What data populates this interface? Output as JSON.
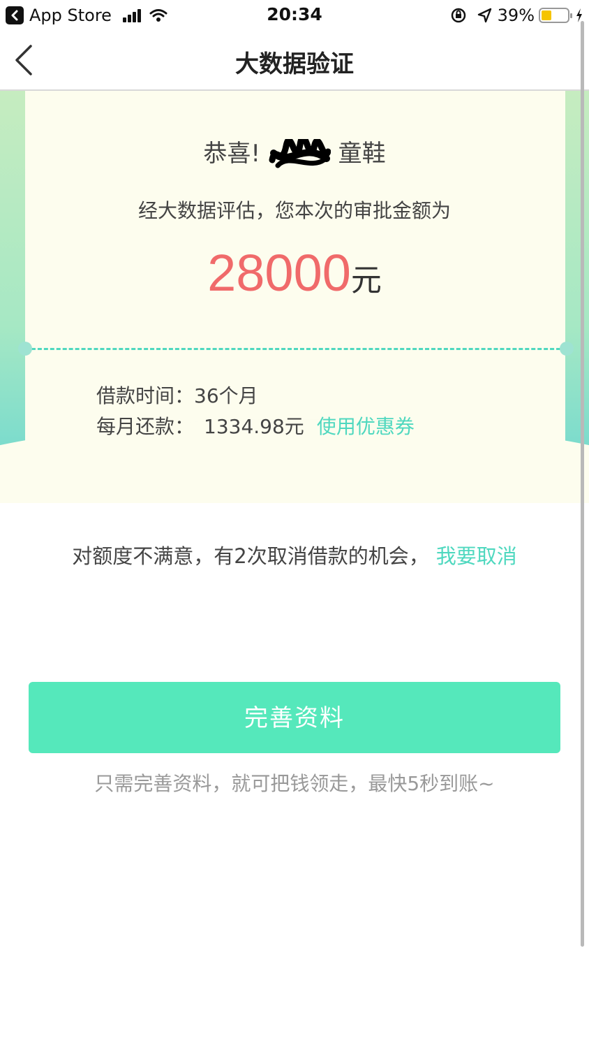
{
  "status_bar": {
    "back_app": "App Store",
    "time": "20:34",
    "battery_percent": "39%",
    "battery_level": 0.39,
    "battery_color": "#f5c400"
  },
  "nav": {
    "title": "大数据验证",
    "back_icon": "chevron-left-icon"
  },
  "result": {
    "congrats_prefix": "恭喜!",
    "congrats_suffix": "童鞋",
    "description": "经大数据评估，您本次的审批金额为",
    "amount": "28000",
    "amount_unit": "元",
    "amount_color": "#f06a6a",
    "term_label": "借款时间：",
    "term_value": "36个月",
    "monthly_label": "每月还款：",
    "monthly_value": "1334.98元",
    "coupon_link": "使用优惠券"
  },
  "cancel": {
    "text": "对额度不满意，有2次取消借款的机会，",
    "link": "我要取消"
  },
  "primary_button": {
    "label": "完善资料",
    "color": "#55e8bb"
  },
  "hint": "只需完善资料，就可把钱领走，最快5秒到账~",
  "accent_color": "#4fd8bf"
}
